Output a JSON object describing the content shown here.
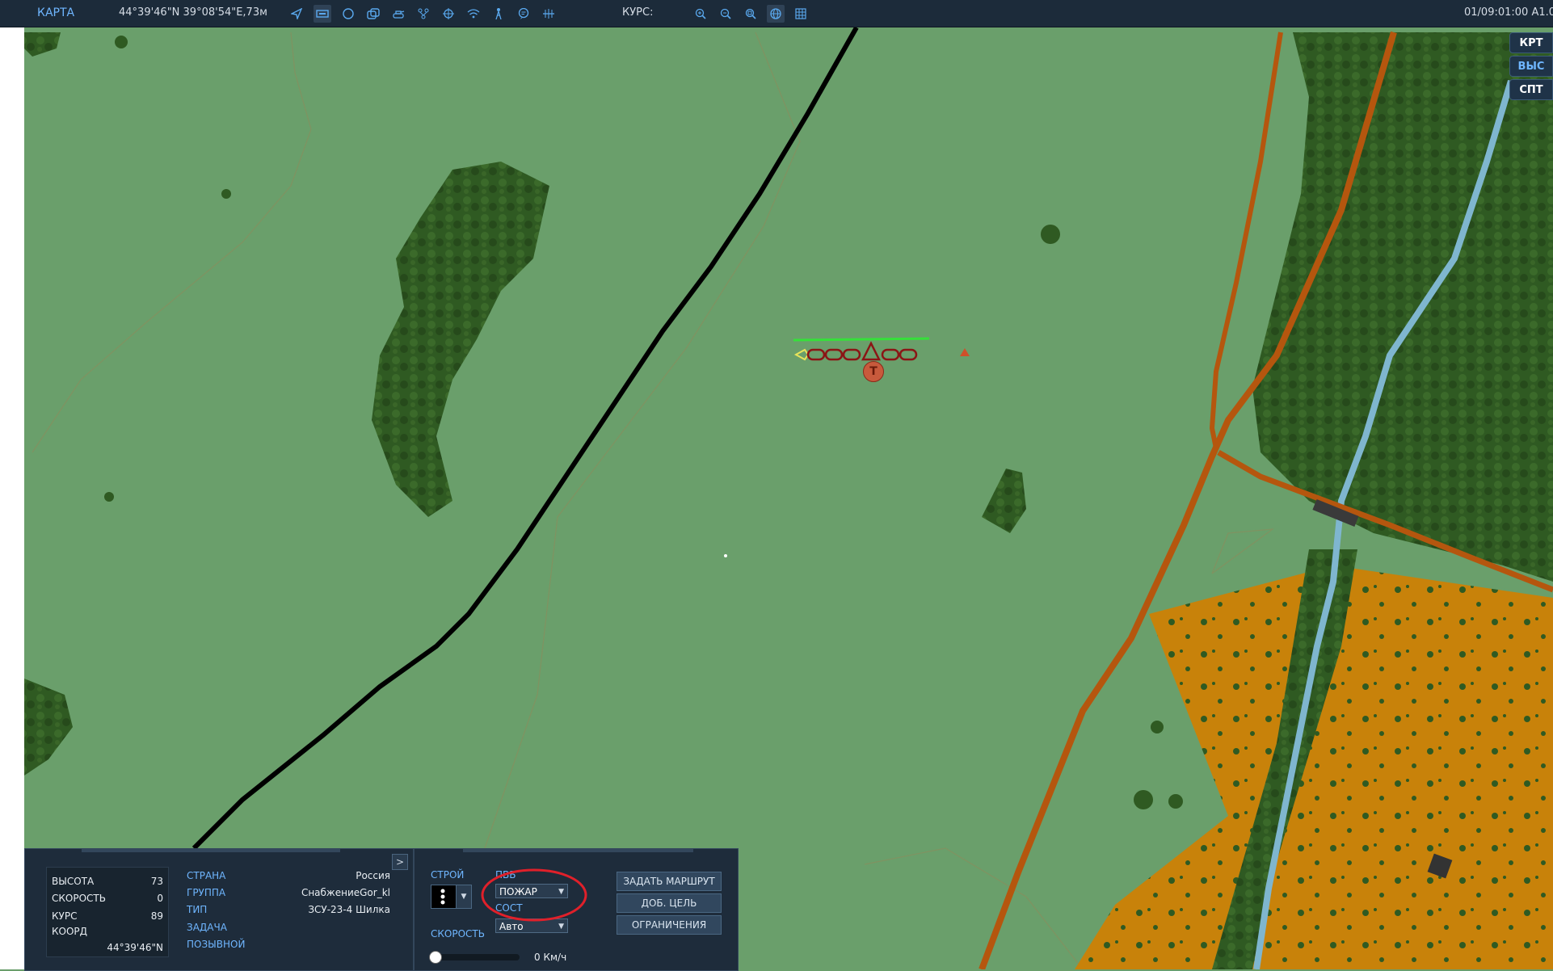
{
  "topbar": {
    "title": "КАРТА",
    "coords": "44°39'46\"N 39°08'54\"E,73м",
    "course_label": "КУРС:",
    "time": "01/09:01:00 A1.0",
    "icons": [
      "navigate-icon",
      "unit-icon",
      "circle-icon",
      "layers-icon",
      "tank-icon",
      "network-icon",
      "target-icon",
      "wifi-icon",
      "tower-icon",
      "chat-icon",
      "ruler-icon",
      "zoom-in-icon",
      "zoom-out-icon",
      "zoom-fit-icon",
      "globe-icon",
      "grid-icon"
    ]
  },
  "side_tabs": [
    "КРТ",
    "ВЫС",
    "СПТ"
  ],
  "map_unit": {
    "marker_label": "Т"
  },
  "info_panel": {
    "altitude_label": "ВЫСОТА",
    "altitude": "73",
    "speed_label": "СКОРОСТЬ",
    "speed": "0",
    "course_label": "КУРС",
    "course": "89",
    "coord_label": "КООРД",
    "coord": "44°39'46\"N",
    "country_label": "СТРАНА",
    "country": "Россия",
    "group_label": "ГРУППА",
    "group": "СнабжениеGor_kl",
    "type_label": "ТИП",
    "type": "ЗСУ-23-4 Шилка",
    "task_label": "ЗАДАЧА",
    "callsign_label": "ПОЗЫВНОЙ",
    "expand": ">"
  },
  "control_panel": {
    "formation_label": "СТРОЙ",
    "roe_label": "ПВБ",
    "roe_value": "ПОЖАР",
    "alarm_label": "СОСТ",
    "alarm_value": "Авто",
    "speed_label": "СКОРОСТЬ",
    "speed_value": "0 Км/ч",
    "speed_fraction": 0,
    "route_button": "ЗАДАТЬ МАРШРУТ",
    "add_target_button": "ДОБ. ЦЕЛЬ",
    "restrictions_button": "ОГРАНИЧЕНИЯ"
  },
  "colors": {
    "grass": "#6a9f6b",
    "forest": "#2f5a22",
    "road": "#b5560e",
    "river": "#7fb6cf",
    "urban": "#c8820a",
    "highlight": "#e0202a"
  }
}
